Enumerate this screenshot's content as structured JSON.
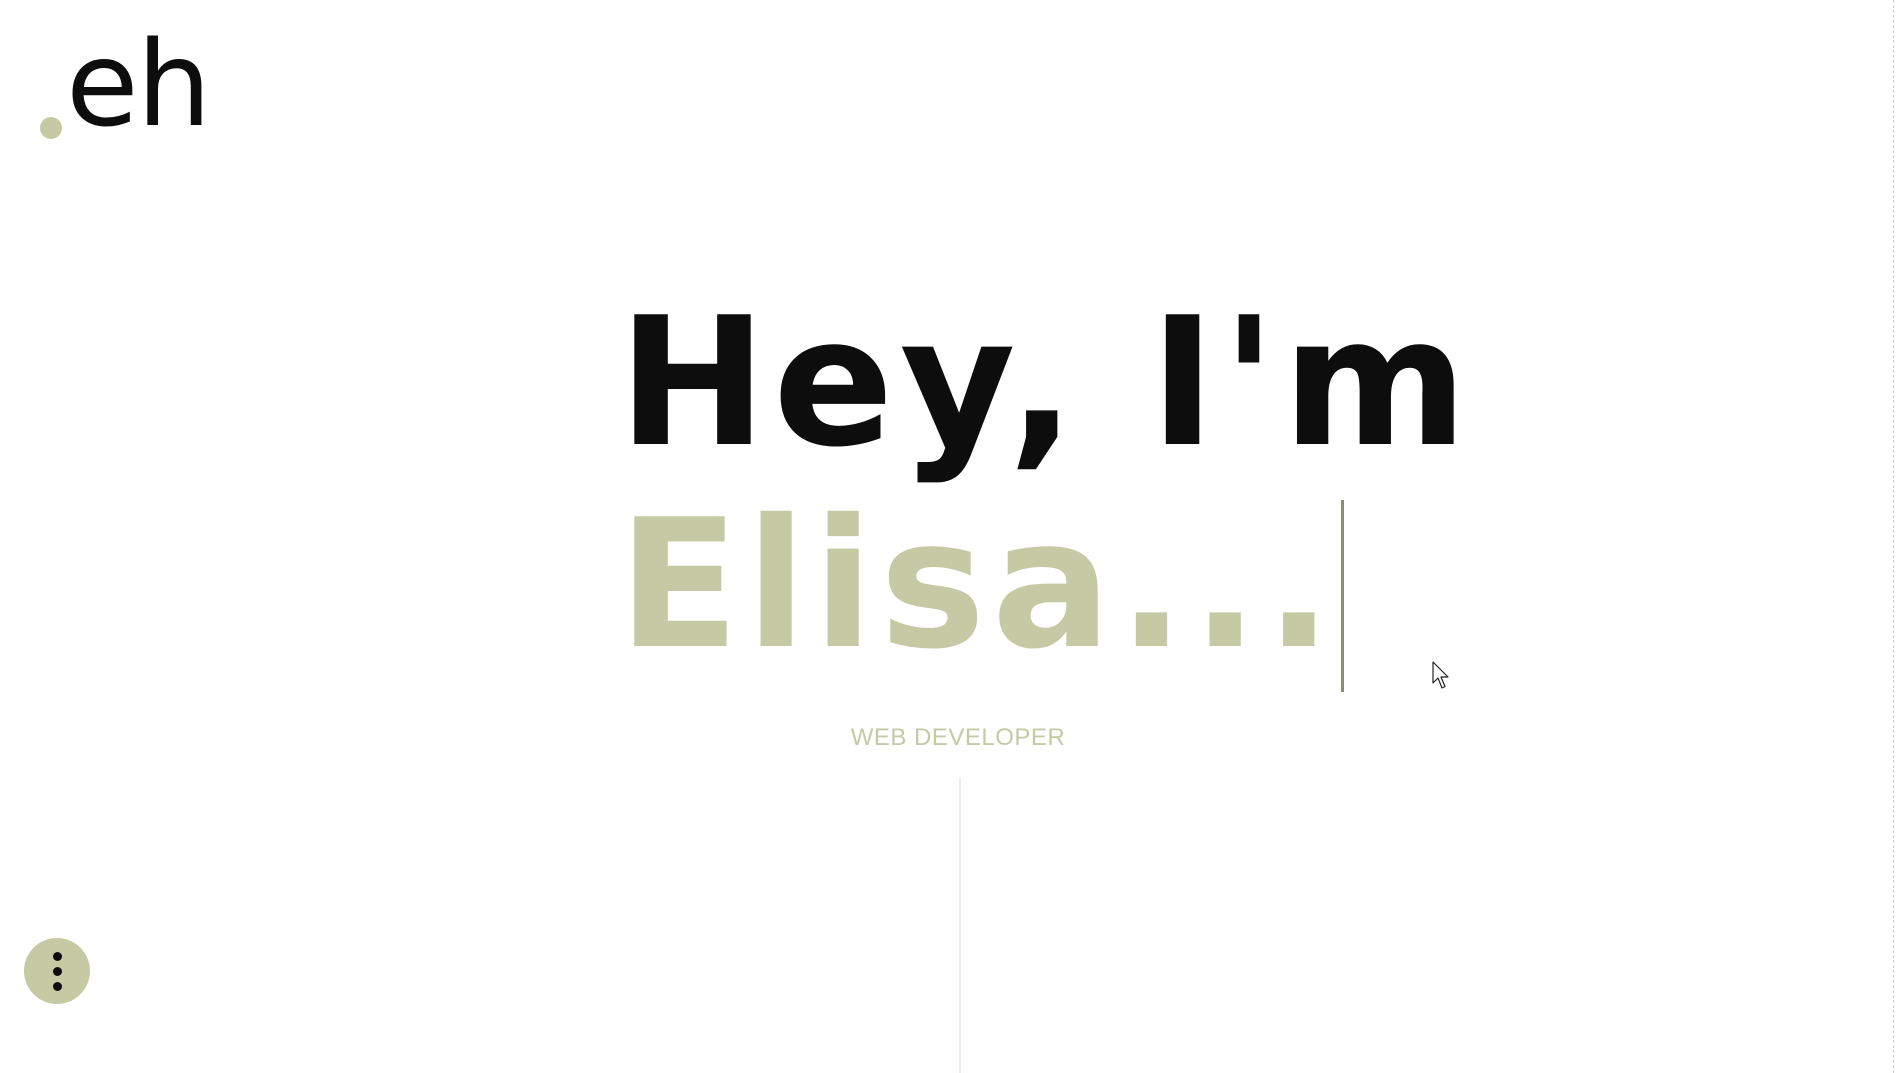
{
  "logo": {
    "text": "eh"
  },
  "hero": {
    "line1": "Hey, I'm",
    "name": "Elisa..."
  },
  "subtitle": "WEB DEVELOPER",
  "menu_button": {
    "icon": "more-vertical-icon"
  },
  "colors": {
    "accent": "#c5caa4",
    "text": "#0d0d0d",
    "background": "#ffffff"
  }
}
